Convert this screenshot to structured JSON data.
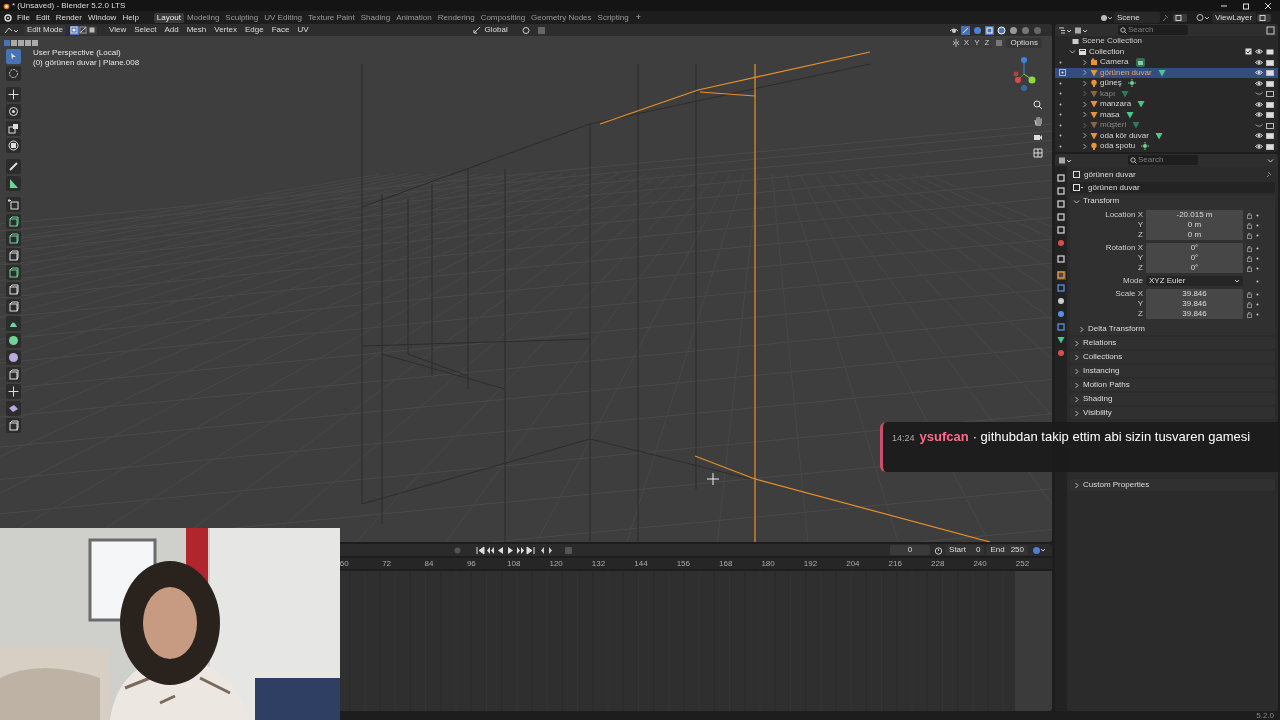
{
  "window": {
    "title": "* (Unsaved) - Blender 5.2.0 LTS"
  },
  "menu": [
    "File",
    "Edit",
    "Render",
    "Window",
    "Help"
  ],
  "workspaces": [
    {
      "label": "Layout",
      "selected": true
    },
    {
      "label": "Modeling",
      "selected": false
    },
    {
      "label": "Sculpting",
      "selected": false
    },
    {
      "label": "UV Editing",
      "selected": false
    },
    {
      "label": "Texture Paint",
      "selected": false
    },
    {
      "label": "Shading",
      "selected": false
    },
    {
      "label": "Animation",
      "selected": false
    },
    {
      "label": "Rendering",
      "selected": false
    },
    {
      "label": "Compositing",
      "selected": false
    },
    {
      "label": "Geometry Nodes",
      "selected": false
    },
    {
      "label": "Scripting",
      "selected": false
    }
  ],
  "add_workspace": "+",
  "scene": "Scene",
  "view_layer": "ViewLayer",
  "viewport": {
    "mode": "Edit Mode",
    "select_modes": [
      {
        "selected": true
      },
      {
        "selected": false
      },
      {
        "selected": false
      }
    ],
    "menus": [
      "View",
      "Select",
      "Add",
      "Mesh",
      "Vertex",
      "Edge",
      "Face",
      "UV"
    ],
    "orientation": "Global",
    "axes": [
      "X",
      "Y",
      "Z"
    ],
    "options": "Options",
    "info": [
      "User Perspective (Local)",
      "(0) görünen duvar | Plane.008"
    ],
    "tools": [
      {
        "selected": true
      },
      {
        "selected": false
      },
      {
        "selected": false
      },
      {
        "selected": false
      },
      {
        "selected": false
      },
      {
        "selected": false
      },
      {
        "selected": false
      },
      {
        "selected": false
      },
      {
        "selected": false
      },
      {
        "selected": false
      },
      {
        "selected": false
      },
      {
        "selected": false
      },
      {
        "selected": false
      },
      {
        "selected": false
      },
      {
        "selected": false
      },
      {
        "selected": false
      },
      {
        "selected": false
      },
      {
        "selected": false
      },
      {
        "selected": false
      },
      {
        "selected": false
      },
      {
        "selected": false
      },
      {
        "selected": false
      }
    ]
  },
  "timeline": {
    "current_frame": "0",
    "start_label": "Start",
    "start": "0",
    "end_label": "End",
    "end": "250",
    "ruler": [
      "60",
      "72",
      "84",
      "96",
      "108",
      "120",
      "132",
      "144",
      "156",
      "168",
      "180",
      "192",
      "204",
      "216",
      "228",
      "240",
      "252"
    ]
  },
  "outliner": {
    "search_placeholder": "Search",
    "scene_collection": "Scene Collection",
    "collection": "Collection",
    "objects": [
      {
        "name": "Camera",
        "kind": "camera",
        "selected": false,
        "visible": true
      },
      {
        "name": "görünen duvar",
        "kind": "mesh",
        "selected": true,
        "visible": true
      },
      {
        "name": "güneş",
        "kind": "light",
        "selected": false,
        "visible": true
      },
      {
        "name": "kapı",
        "kind": "mesh",
        "selected": false,
        "visible": false
      },
      {
        "name": "manzara",
        "kind": "mesh",
        "selected": false,
        "visible": true
      },
      {
        "name": "masa",
        "kind": "mesh",
        "selected": false,
        "visible": true
      },
      {
        "name": "müşteri",
        "kind": "mesh",
        "selected": false,
        "visible": false
      },
      {
        "name": "oda kör duvar",
        "kind": "mesh",
        "selected": false,
        "visible": true
      },
      {
        "name": "oda spotu",
        "kind": "light",
        "selected": false,
        "visible": true
      }
    ]
  },
  "properties": {
    "search_placeholder": "Search",
    "tabs": [
      {
        "selected": false
      },
      {
        "selected": false
      },
      {
        "selected": false
      },
      {
        "selected": false
      },
      {
        "selected": false
      },
      {
        "selected": false
      },
      {
        "selected": false
      },
      {
        "selected": true
      },
      {
        "selected": false
      },
      {
        "selected": false
      },
      {
        "selected": false
      },
      {
        "selected": false
      },
      {
        "selected": false
      },
      {
        "selected": false
      }
    ],
    "object": "görünen duvar",
    "datablock": "görünen duvar",
    "transform": {
      "title": "Transform",
      "expanded": true,
      "rows": [
        {
          "kind": "field",
          "label": "Location X",
          "value": "-20.015 m",
          "group_start": true
        },
        {
          "kind": "field",
          "label": "Y",
          "value": "0 m",
          "group_start": false
        },
        {
          "kind": "field",
          "label": "Z",
          "value": "0 m",
          "group_start": false
        },
        {
          "kind": "field",
          "label": "Rotation X",
          "value": "0°",
          "group_start": true
        },
        {
          "kind": "field",
          "label": "Y",
          "value": "0°",
          "group_start": false
        },
        {
          "kind": "field",
          "label": "Z",
          "value": "0°",
          "group_start": false
        },
        {
          "kind": "dropdown",
          "label": "Mode",
          "value": "XYZ Euler",
          "group_start": true
        },
        {
          "kind": "field",
          "label": "Scale X",
          "value": "39.846",
          "group_start": true
        },
        {
          "kind": "field",
          "label": "Y",
          "value": "39.846",
          "group_start": false
        },
        {
          "kind": "field",
          "label": "Z",
          "value": "39.846",
          "group_start": false
        }
      ],
      "subpanels": [
        {
          "title": "Delta Transform",
          "expanded": false
        }
      ]
    },
    "panels": [
      {
        "title": "Relations",
        "expanded": false
      },
      {
        "title": "Collections",
        "expanded": false
      },
      {
        "title": "Instancing",
        "expanded": false
      },
      {
        "title": "Motion Paths",
        "expanded": false
      },
      {
        "title": "Shading",
        "expanded": false
      },
      {
        "title": "Visibility",
        "expanded": false
      },
      {
        "title": "Custom Properties",
        "expanded": false
      }
    ]
  },
  "chat": {
    "time": "14:24",
    "user": "ysufcan",
    "message": "· githubdan takip ettim abi sizin tusvaren gamesi"
  },
  "version": "5.2.0"
}
